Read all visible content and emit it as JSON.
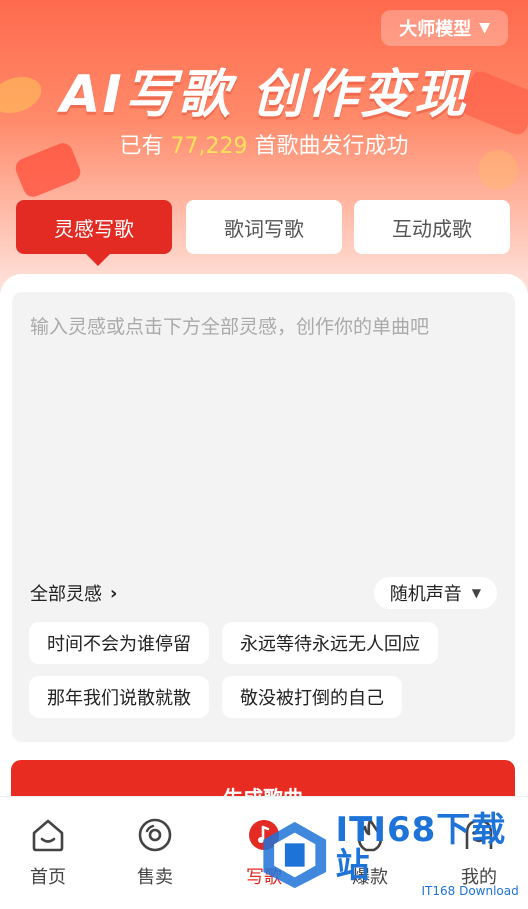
{
  "header": {
    "model_selector": "大师模型",
    "title": "AI写歌 创作变现",
    "subtitle_prefix": "已有",
    "song_count": "77,229",
    "subtitle_suffix": "首歌曲发行成功"
  },
  "tabs": [
    {
      "label": "灵感写歌",
      "active": true
    },
    {
      "label": "歌词写歌",
      "active": false
    },
    {
      "label": "互动成歌",
      "active": false
    }
  ],
  "editor": {
    "placeholder": "输入灵感或点击下方全部灵感，创作你的单曲吧",
    "all_inspiration_label": "全部灵感",
    "voice_selector": "随机声音"
  },
  "inspirations": [
    "时间不会为谁停留",
    "永远等待永远无人回应",
    "那年我们说散就散",
    "敬没被打倒的自己"
  ],
  "generate_button": "生成歌曲",
  "nav": [
    {
      "label": "首页",
      "icon": "home-icon"
    },
    {
      "label": "售卖",
      "icon": "disc-icon"
    },
    {
      "label": "写歌",
      "icon": "music-note-icon"
    },
    {
      "label": "爆款",
      "icon": "flame-icon"
    },
    {
      "label": "我的",
      "icon": "profile-icon"
    }
  ],
  "watermark": {
    "main": "ITI68下载站",
    "sub": "IT168 Download"
  },
  "colors": {
    "accent": "#e42b23",
    "highlight": "#ffe15a",
    "watermark": "#1e73d8"
  }
}
